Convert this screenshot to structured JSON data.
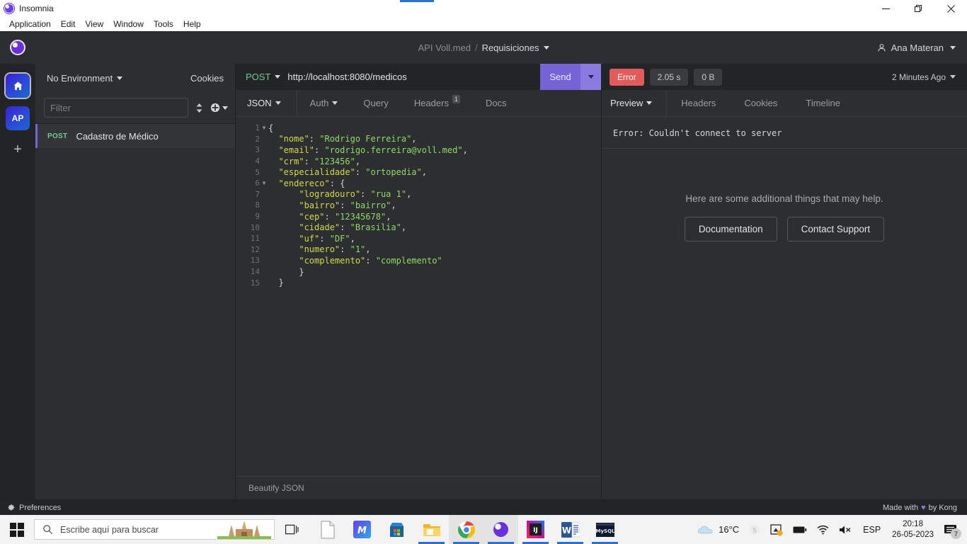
{
  "window": {
    "title": "Insomnia",
    "minimize_label": "Minimize",
    "maximize_label": "Maximize",
    "close_label": "Close"
  },
  "menubar": {
    "items": [
      {
        "label": "Application"
      },
      {
        "label": "Edit"
      },
      {
        "label": "View"
      },
      {
        "label": "Window"
      },
      {
        "label": "Tools"
      },
      {
        "label": "Help"
      }
    ]
  },
  "header": {
    "project": "API Voll.med",
    "separator": "/",
    "workspace": "Requisiciones",
    "account_name": "Ana Materan",
    "account_icon": "user-icon",
    "logo_icon": "insomnia-logo-icon"
  },
  "rail": {
    "items": [
      {
        "name": "home",
        "icon": "home-icon",
        "label": "",
        "selected": true
      },
      {
        "name": "workspace-ap",
        "icon": "workspace-icon",
        "label": "AP",
        "selected": false
      }
    ],
    "add_label": "+"
  },
  "sidebar": {
    "environment": "No Environment",
    "cookies_label": "Cookies",
    "filter_placeholder": "Filter",
    "filter_value": "",
    "sort_icon": "sort-icon",
    "add_icon": "plus-circle-icon",
    "requests": [
      {
        "method": "POST",
        "name": "Cadastro de Médico",
        "selected": true
      }
    ]
  },
  "request": {
    "method": "POST",
    "url": "http://localhost:8080/medicos",
    "send_label": "Send",
    "send_caret_icon": "chevron-down-icon",
    "tabs": [
      {
        "label": "JSON",
        "has_caret": true,
        "kind": "body"
      },
      {
        "label": "Auth",
        "has_caret": true,
        "kind": "tab"
      },
      {
        "label": "Query",
        "has_caret": false,
        "kind": "tab"
      },
      {
        "label": "Headers",
        "has_caret": false,
        "kind": "tab",
        "badge": "1"
      },
      {
        "label": "Docs",
        "has_caret": false,
        "kind": "tab"
      }
    ],
    "beautify_label": "Beautify JSON",
    "body_lines": [
      {
        "n": 1,
        "fold": true,
        "tokens": [
          {
            "t": "p",
            "v": "{"
          }
        ]
      },
      {
        "n": 2,
        "fold": false,
        "tokens": [
          {
            "t": "k",
            "v": "  \"nome\""
          },
          {
            "t": "p",
            "v": ": "
          },
          {
            "t": "s",
            "v": "\"Rodrigo Ferreira\""
          },
          {
            "t": "p",
            "v": ","
          }
        ]
      },
      {
        "n": 3,
        "fold": false,
        "tokens": [
          {
            "t": "k",
            "v": "  \"email\""
          },
          {
            "t": "p",
            "v": ": "
          },
          {
            "t": "s",
            "v": "\"rodrigo.ferreira@voll.med\""
          },
          {
            "t": "p",
            "v": ","
          }
        ]
      },
      {
        "n": 4,
        "fold": false,
        "tokens": [
          {
            "t": "k",
            "v": "  \"crm\""
          },
          {
            "t": "p",
            "v": ": "
          },
          {
            "t": "s",
            "v": "\"123456\""
          },
          {
            "t": "p",
            "v": ","
          }
        ]
      },
      {
        "n": 5,
        "fold": false,
        "tokens": [
          {
            "t": "k",
            "v": "  \"especialidade\""
          },
          {
            "t": "p",
            "v": ": "
          },
          {
            "t": "s",
            "v": "\"ortopedia\""
          },
          {
            "t": "p",
            "v": ","
          }
        ]
      },
      {
        "n": 6,
        "fold": true,
        "tokens": [
          {
            "t": "k",
            "v": "  \"endereco\""
          },
          {
            "t": "p",
            "v": ": {"
          }
        ]
      },
      {
        "n": 7,
        "fold": false,
        "tokens": [
          {
            "t": "k",
            "v": "      \"logradouro\""
          },
          {
            "t": "p",
            "v": ": "
          },
          {
            "t": "s",
            "v": "\"rua 1\""
          },
          {
            "t": "p",
            "v": ","
          }
        ]
      },
      {
        "n": 8,
        "fold": false,
        "tokens": [
          {
            "t": "k",
            "v": "      \"bairro\""
          },
          {
            "t": "p",
            "v": ": "
          },
          {
            "t": "s",
            "v": "\"bairro\""
          },
          {
            "t": "p",
            "v": ","
          }
        ]
      },
      {
        "n": 9,
        "fold": false,
        "tokens": [
          {
            "t": "k",
            "v": "      \"cep\""
          },
          {
            "t": "p",
            "v": ": "
          },
          {
            "t": "s",
            "v": "\"12345678\""
          },
          {
            "t": "p",
            "v": ","
          }
        ]
      },
      {
        "n": 10,
        "fold": false,
        "tokens": [
          {
            "t": "k",
            "v": "      \"cidade\""
          },
          {
            "t": "p",
            "v": ": "
          },
          {
            "t": "s",
            "v": "\"Brasilia\""
          },
          {
            "t": "p",
            "v": ","
          }
        ]
      },
      {
        "n": 11,
        "fold": false,
        "tokens": [
          {
            "t": "k",
            "v": "      \"uf\""
          },
          {
            "t": "p",
            "v": ": "
          },
          {
            "t": "s",
            "v": "\"DF\""
          },
          {
            "t": "p",
            "v": ","
          }
        ]
      },
      {
        "n": 12,
        "fold": false,
        "tokens": [
          {
            "t": "k",
            "v": "      \"numero\""
          },
          {
            "t": "p",
            "v": ": "
          },
          {
            "t": "s",
            "v": "\"1\""
          },
          {
            "t": "p",
            "v": ","
          }
        ]
      },
      {
        "n": 13,
        "fold": false,
        "tokens": [
          {
            "t": "k",
            "v": "      \"complemento\""
          },
          {
            "t": "p",
            "v": ": "
          },
          {
            "t": "s",
            "v": "\"complemento\""
          }
        ]
      },
      {
        "n": 14,
        "fold": false,
        "tokens": [
          {
            "t": "p",
            "v": "      }"
          }
        ]
      },
      {
        "n": 15,
        "fold": false,
        "tokens": [
          {
            "t": "p",
            "v": "  }"
          }
        ]
      }
    ]
  },
  "response": {
    "status_label": "Error",
    "time_label": "2.05 s",
    "size_label": "0 B",
    "timestamp": "2 Minutes Ago",
    "tabs": [
      {
        "label": "Preview",
        "has_caret": true,
        "selected": true
      },
      {
        "label": "Headers",
        "has_caret": false,
        "selected": false
      },
      {
        "label": "Cookies",
        "has_caret": false,
        "selected": false
      },
      {
        "label": "Timeline",
        "has_caret": false,
        "selected": false
      }
    ],
    "error_text": "Error: Couldn't connect to server",
    "help_line": "Here are some additional things that may help.",
    "help_buttons": [
      {
        "label": "Documentation"
      },
      {
        "label": "Contact Support"
      }
    ]
  },
  "statusbar": {
    "preferences_label": "Preferences",
    "preferences_icon": "gear-icon",
    "made_with_prefix": "Made with",
    "made_with_suffix": "by Kong",
    "heart_icon": "heart-icon"
  },
  "taskbar": {
    "start_icon": "windows-start-icon",
    "search_placeholder": "Escribe aquí para buscar",
    "search_icon": "search-icon",
    "taskview_icon": "task-view-icon",
    "apps": [
      {
        "name": "notepad",
        "icon": "document-icon",
        "open": false,
        "active": false
      },
      {
        "name": "blue-app",
        "icon": "blue-app-icon",
        "open": false,
        "active": false
      },
      {
        "name": "microsoft-store",
        "icon": "store-icon",
        "open": false,
        "active": false
      },
      {
        "name": "file-explorer",
        "icon": "folder-icon",
        "open": true,
        "active": false
      },
      {
        "name": "chrome",
        "icon": "chrome-icon",
        "open": true,
        "active": true
      },
      {
        "name": "insomnia",
        "icon": "insomnia-icon",
        "open": true,
        "active": true
      },
      {
        "name": "intellij-idea",
        "icon": "intellij-icon",
        "open": true,
        "active": false
      },
      {
        "name": "word",
        "icon": "word-icon",
        "open": true,
        "active": false
      },
      {
        "name": "mysql",
        "icon": "mysql-icon",
        "open": true,
        "active": false
      }
    ],
    "tray": {
      "weather_temp": "16°C",
      "weather_icon": "cloud-icon",
      "skype_icon": "skype-icon",
      "onedrive_icon": "onedrive-sync-icon",
      "battery_icon": "battery-icon",
      "wifi_icon": "wifi-icon",
      "volume_icon": "volume-muted-icon",
      "language": "ESP",
      "time": "20:18",
      "date": "26-05-2023",
      "notifications_icon": "notifications-icon",
      "notifications_count": "7"
    }
  },
  "colors": {
    "accent": "#7664d6",
    "error": "#e15b5b",
    "method_post": "#74c991",
    "json_key": "#d4d94a",
    "json_string": "#8fd96a",
    "app_bg": "#2d2e2f",
    "panel_bg": "#232425"
  }
}
